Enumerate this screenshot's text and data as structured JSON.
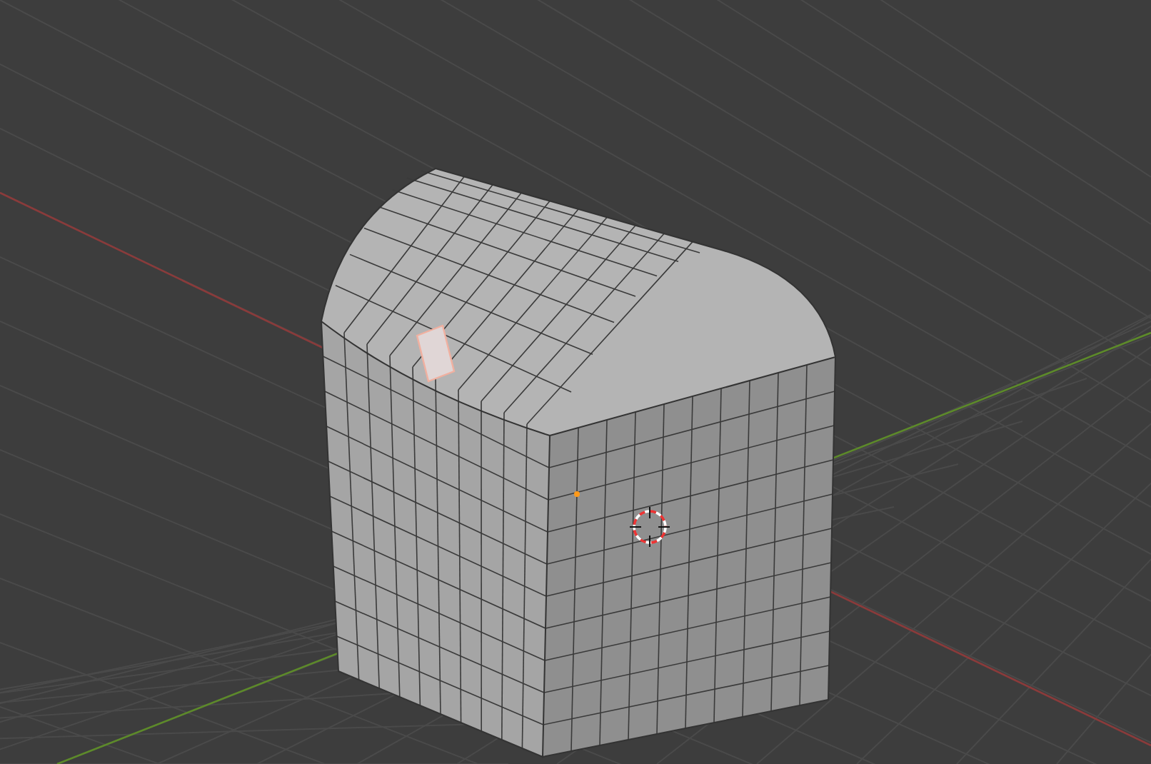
{
  "viewport": {
    "grid": true,
    "object": {
      "kind": "mesh",
      "edit_mode": true,
      "face_selected": true
    },
    "cursor_3d": true
  }
}
